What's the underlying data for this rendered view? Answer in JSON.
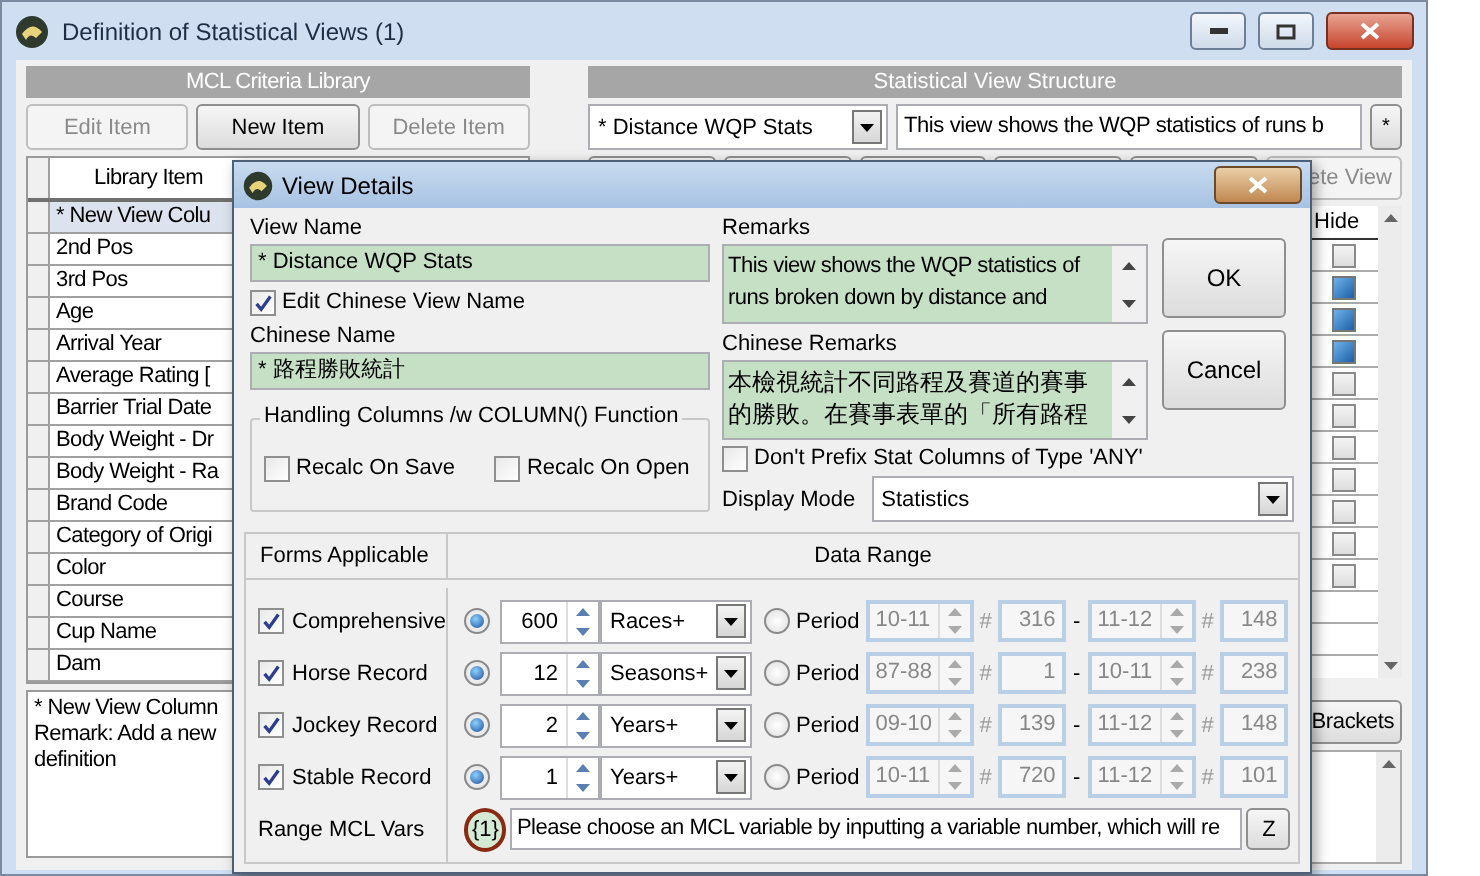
{
  "window": {
    "title": "Definition of Statistical Views  (1)"
  },
  "library": {
    "header": "MCL Criteria Library",
    "buttons": [
      {
        "label": "Edit Item",
        "disabled": true
      },
      {
        "label": "New Item",
        "disabled": false
      },
      {
        "label": "Delete Item",
        "disabled": true
      }
    ],
    "column": "Library Item",
    "rows": [
      {
        "label": "* New View Colu",
        "selected": true
      },
      {
        "label": "2nd Pos",
        "selected": false
      },
      {
        "label": "3rd Pos",
        "selected": false
      },
      {
        "label": "Age",
        "selected": false
      },
      {
        "label": "Arrival Year",
        "selected": false
      },
      {
        "label": "Average Rating [",
        "selected": false
      },
      {
        "label": "Barrier Trial Date",
        "selected": false
      },
      {
        "label": "Body Weight - Dr",
        "selected": false
      },
      {
        "label": "Body Weight - Ra",
        "selected": false
      },
      {
        "label": "Brand Code",
        "selected": false
      },
      {
        "label": "Category of Origi",
        "selected": false
      },
      {
        "label": "Color",
        "selected": false
      },
      {
        "label": "Course",
        "selected": false
      },
      {
        "label": "Cup Name",
        "selected": false
      },
      {
        "label": "Dam",
        "selected": false
      }
    ],
    "remark": [
      "* New View Column",
      "Remark: Add a new",
      "definition"
    ]
  },
  "structure": {
    "header": "Statistical View Structure",
    "view_select": "* Distance WQP Stats",
    "description": "This view shows the WQP statistics of runs b",
    "star_button": "*",
    "toolbar_button": "ete View",
    "hide_column": "Hide",
    "hide_rows": [
      {
        "checked": false
      },
      {
        "checked": true
      },
      {
        "checked": true
      },
      {
        "checked": true
      },
      {
        "checked": false
      },
      {
        "checked": false
      },
      {
        "checked": false
      },
      {
        "checked": false
      },
      {
        "checked": false
      },
      {
        "checked": false
      },
      {
        "checked": false
      }
    ],
    "brackets_button": "Brackets"
  },
  "dialog": {
    "title": "View Details",
    "view_name": {
      "label": "View Name",
      "value": "* Distance WQP Stats"
    },
    "edit_chinese": {
      "label": "Edit Chinese View Name",
      "checked": true
    },
    "chinese_name": {
      "label": "Chinese Name",
      "value": "* 路程勝敗統計"
    },
    "handling": {
      "title": "Handling Columns /w COLUMN() Function",
      "options": [
        {
          "label": "Recalc On Save",
          "checked": false
        },
        {
          "label": "Recalc On Open",
          "checked": false
        }
      ]
    },
    "remarks": {
      "label": "Remarks",
      "lines": [
        "This view shows the WQP statistics of",
        "runs broken down by distance and"
      ]
    },
    "chinese_remarks": {
      "label": "Chinese Remarks",
      "lines": [
        "本檢視統計不同路程及賽道的賽事",
        "的勝敗。在賽事表單的「所有路程"
      ]
    },
    "no_prefix": {
      "label": "Don't Prefix Stat Columns of Type 'ANY'",
      "checked": false
    },
    "display_mode": {
      "label": "Display Mode",
      "value": "Statistics"
    },
    "buttons": [
      "OK",
      "Cancel"
    ],
    "forms": {
      "header": "Forms Applicable",
      "range_header": "Data Range",
      "rows": [
        {
          "label": "Comprehensive",
          "checked": true,
          "recent_selected": true,
          "count": "600",
          "unit": "Races+",
          "period_selected": false,
          "period_label": "Period",
          "from": "10-11",
          "from_mark": "#",
          "from_no": "316",
          "dash": "-",
          "to": "11-12",
          "to_mark": "#",
          "to_no": "148"
        },
        {
          "label": "Horse Record",
          "checked": true,
          "recent_selected": true,
          "count": "12",
          "unit": "Seasons+",
          "period_selected": false,
          "period_label": "Period",
          "from": "87-88",
          "from_mark": "#",
          "from_no": "1",
          "dash": "-",
          "to": "10-11",
          "to_mark": "#",
          "to_no": "238"
        },
        {
          "label": "Jockey Record",
          "checked": true,
          "recent_selected": true,
          "count": "2",
          "unit": "Years+",
          "period_selected": false,
          "period_label": "Period",
          "from": "09-10",
          "from_mark": "#",
          "from_no": "139",
          "dash": "-",
          "to": "11-12",
          "to_mark": "#",
          "to_no": "148"
        },
        {
          "label": "Stable Record",
          "checked": true,
          "recent_selected": true,
          "count": "1",
          "unit": "Years+",
          "period_selected": false,
          "period_label": "Period",
          "from": "10-11",
          "from_mark": "#",
          "from_no": "720",
          "dash": "-",
          "to": "11-12",
          "to_mark": "#",
          "to_no": "101"
        }
      ]
    },
    "mcl": {
      "label": "Range MCL Vars",
      "var": "{1}",
      "value": "Please choose an MCL variable by inputting a variable number, which will re",
      "button": "Z"
    }
  }
}
